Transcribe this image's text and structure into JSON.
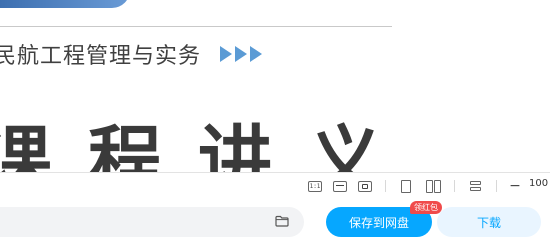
{
  "document": {
    "subtitle": "民航工程管理与实务",
    "big_title": "课程讲义"
  },
  "toolbar": {
    "ratio_label": "1:1",
    "zoom": "100"
  },
  "actions": {
    "save_label": "保存到网盘",
    "badge": "领红包",
    "download_label": "下载"
  },
  "colors": {
    "accent": "#06a7ff",
    "badge": "#f04b4b",
    "arrow": "#5b9bd5"
  }
}
